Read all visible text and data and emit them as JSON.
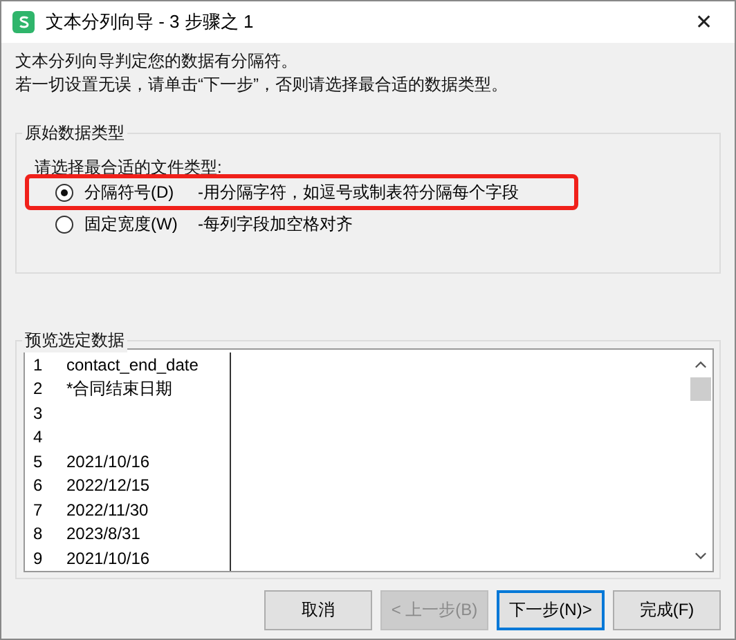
{
  "window": {
    "title": "文本分列向导 - 3 步骤之 1",
    "close": "✕"
  },
  "intro": [
    "文本分列向导判定您的数据有分隔符。",
    "若一切设置无误，请单击“下一步”，否则请选择最合适的数据类型。"
  ],
  "original_type": {
    "title": "原始数据类型",
    "prompt": "请选择最合适的文件类型:",
    "options": [
      {
        "label": "分隔符号(D)",
        "description": "-用分隔字符，如逗号或制表符分隔每个字段",
        "selected": true,
        "highlighted": true
      },
      {
        "label": "固定宽度(W)",
        "description": "-每列字段加空格对齐",
        "selected": false,
        "highlighted": false
      }
    ]
  },
  "preview": {
    "title": "预览选定数据",
    "rows": [
      {
        "number": "1",
        "value": "contact_end_date"
      },
      {
        "number": "2",
        "value": "*合同结束日期"
      },
      {
        "number": "3",
        "value": ""
      },
      {
        "number": "4",
        "value": ""
      },
      {
        "number": "5",
        "value": "2021/10/16"
      },
      {
        "number": "6",
        "value": "2022/12/15"
      },
      {
        "number": "7",
        "value": "2022/11/30"
      },
      {
        "number": "8",
        "value": "2023/8/31"
      },
      {
        "number": "9",
        "value": "2021/10/16"
      }
    ]
  },
  "buttons": [
    {
      "label": "取消",
      "disabled": false,
      "default": false
    },
    {
      "label": "< 上一步(B)",
      "disabled": true,
      "default": false
    },
    {
      "label": "下一步(N)>",
      "disabled": false,
      "default": true
    },
    {
      "label": "完成(F)",
      "disabled": false,
      "default": false
    }
  ]
}
